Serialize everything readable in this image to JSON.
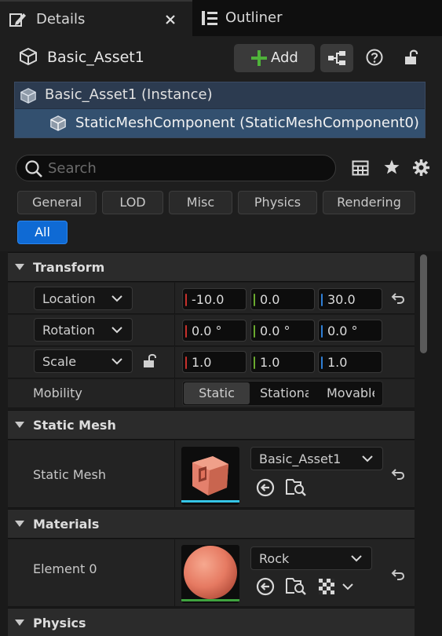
{
  "tabs": [
    {
      "label": "Details",
      "active": true,
      "icon": "pencil-icon"
    },
    {
      "label": "Outliner",
      "active": false,
      "icon": "outliner-icon"
    }
  ],
  "header": {
    "title": "Basic_Asset1",
    "add_label": "Add"
  },
  "tree": {
    "instance": "Basic_Asset1 (Instance)",
    "component": "StaticMeshComponent (StaticMeshComponent0)"
  },
  "search": {
    "placeholder": "Search",
    "value": ""
  },
  "filters": [
    {
      "label": "General",
      "active": false
    },
    {
      "label": "LOD",
      "active": false
    },
    {
      "label": "Misc",
      "active": false
    },
    {
      "label": "Physics",
      "active": false
    },
    {
      "label": "Rendering",
      "active": false
    },
    {
      "label": "All",
      "active": true
    }
  ],
  "transform": {
    "title": "Transform",
    "location": {
      "label": "Location",
      "x": "-10.0",
      "y": "0.0",
      "z": "30.0"
    },
    "rotation": {
      "label": "Rotation",
      "x": "0.0 °",
      "y": "0.0 °",
      "z": "0.0 °"
    },
    "scale": {
      "label": "Scale",
      "x": "1.0",
      "y": "1.0",
      "z": "1.0"
    },
    "mobility": {
      "label": "Mobility",
      "options": [
        "Static",
        "Stationary",
        "Movable"
      ],
      "selected": "Static"
    }
  },
  "static_mesh": {
    "title": "Static Mesh",
    "label": "Static Mesh",
    "value": "Basic_Asset1"
  },
  "materials": {
    "title": "Materials",
    "label": "Element 0",
    "value": "Rock"
  },
  "physics": {
    "title": "Physics"
  },
  "colors": {
    "axis_x": "#c8312c",
    "axis_y": "#6aaa2f",
    "axis_z": "#2f7fd6",
    "accent": "#0f6ad4",
    "mesh_underline": "#35c5e6",
    "material_underline": "#3fa33f"
  }
}
